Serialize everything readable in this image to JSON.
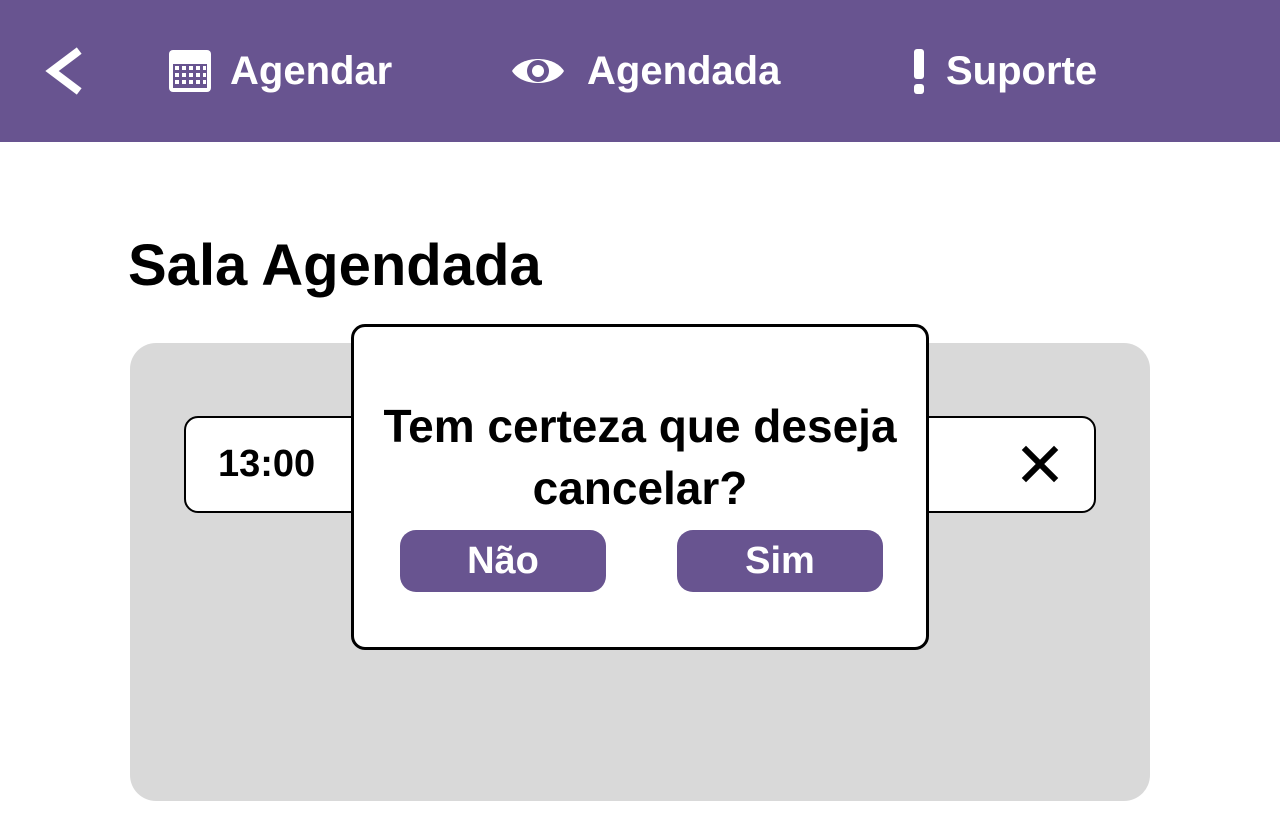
{
  "colors": {
    "brand": "#685490",
    "panel": "#d9d9d9",
    "text": "#000000",
    "on_brand": "#ffffff"
  },
  "nav": {
    "back_icon": "chevron-left-icon",
    "items": [
      {
        "label": "Agendar",
        "icon": "calendar-icon"
      },
      {
        "label": "Agendada",
        "icon": "eye-icon"
      },
      {
        "label": "Suporte",
        "icon": "exclamation-icon"
      }
    ]
  },
  "page": {
    "title": "Sala Agendada"
  },
  "booking": {
    "time": "13:00",
    "cancel_icon": "close-icon"
  },
  "modal": {
    "message": "Tem certeza que deseja cancelar?",
    "no_label": "Não",
    "yes_label": "Sim"
  }
}
